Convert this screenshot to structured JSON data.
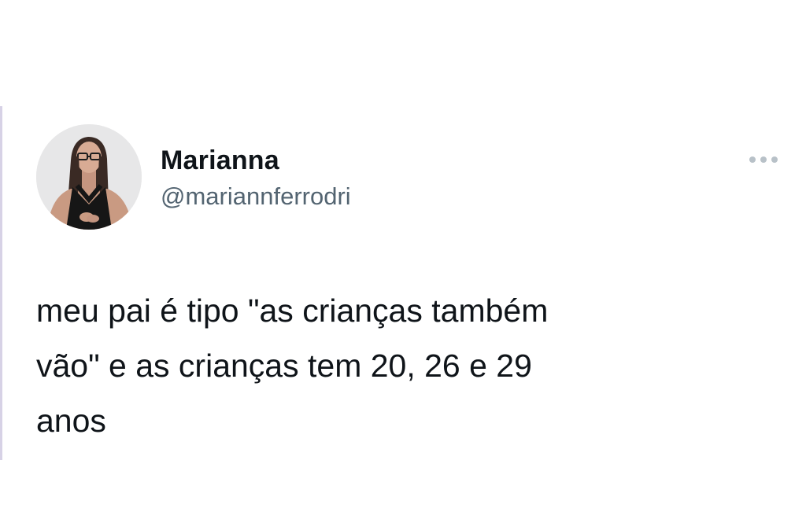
{
  "tweet": {
    "author": {
      "display_name": "Marianna",
      "handle": "@mariannferrodri",
      "avatar_icon": "profile-photo"
    },
    "more_icon": "more-options-icon",
    "text": "meu pai é tipo \"as crianças também\nvão\" e as crianças tem 20, 26 e 29\nanos"
  },
  "colors": {
    "background": "#ffffff",
    "text": "#0f1419",
    "secondary_text": "#536471",
    "more_dots": "#b8c1c8"
  }
}
